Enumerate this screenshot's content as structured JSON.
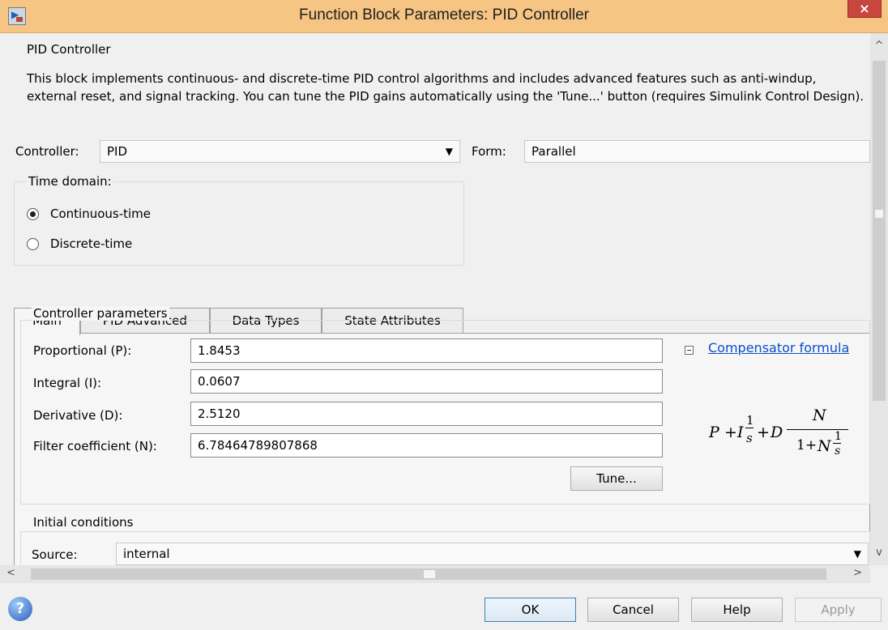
{
  "window": {
    "title": "Function Block Parameters: PID Controller",
    "close_glyph": "×"
  },
  "block": {
    "name": "PID Controller",
    "description": "This block implements continuous- and discrete-time PID control algorithms and includes advanced features such as anti-windup, external reset, and signal tracking. You can tune the PID gains automatically using the 'Tune...' button (requires Simulink Control Design)."
  },
  "controller": {
    "label": "Controller:",
    "value": "PID"
  },
  "form": {
    "label": "Form:",
    "value": "Parallel"
  },
  "time_domain": {
    "title": "Time domain:",
    "options": [
      {
        "label": "Continuous-time",
        "selected": true
      },
      {
        "label": "Discrete-time",
        "selected": false
      }
    ]
  },
  "tabs": [
    {
      "label": "Main",
      "active": true
    },
    {
      "label": "PID Advanced",
      "active": false
    },
    {
      "label": "Data Types",
      "active": false
    },
    {
      "label": "State Attributes",
      "active": false
    }
  ],
  "controller_parameters": {
    "title": "Controller parameters",
    "fields": [
      {
        "label": "Proportional (P):",
        "value": "1.8453"
      },
      {
        "label": "Integral (I):",
        "value": "0.0607"
      },
      {
        "label": "Derivative (D):",
        "value": "2.5120"
      },
      {
        "label": "Filter coefficient (N):",
        "value": "6.78464789807868"
      }
    ],
    "tune_label": "Tune...",
    "compensator_link": "Compensator formula"
  },
  "formula": {
    "p": "P",
    "plus1": "+",
    "i": "I",
    "one": "1",
    "s": "s",
    "plus2": "+",
    "d": "D",
    "n_num": "N",
    "den_one": "1+",
    "den_n": "N",
    "den_frac_one": "1",
    "den_frac_s": "s"
  },
  "initial_conditions": {
    "title": "Initial conditions",
    "source_label": "Source:",
    "source_value": "internal"
  },
  "buttons": {
    "ok": "OK",
    "cancel": "Cancel",
    "help": "Help",
    "apply": "Apply"
  },
  "icons": {
    "help": "help-icon",
    "app": "simulink-block-icon",
    "close": "close-icon",
    "collapse": "collapse-minus-icon"
  },
  "colors": {
    "titlebar": "#f6c584",
    "close": "#c7463d",
    "link": "#0a4fc6"
  }
}
